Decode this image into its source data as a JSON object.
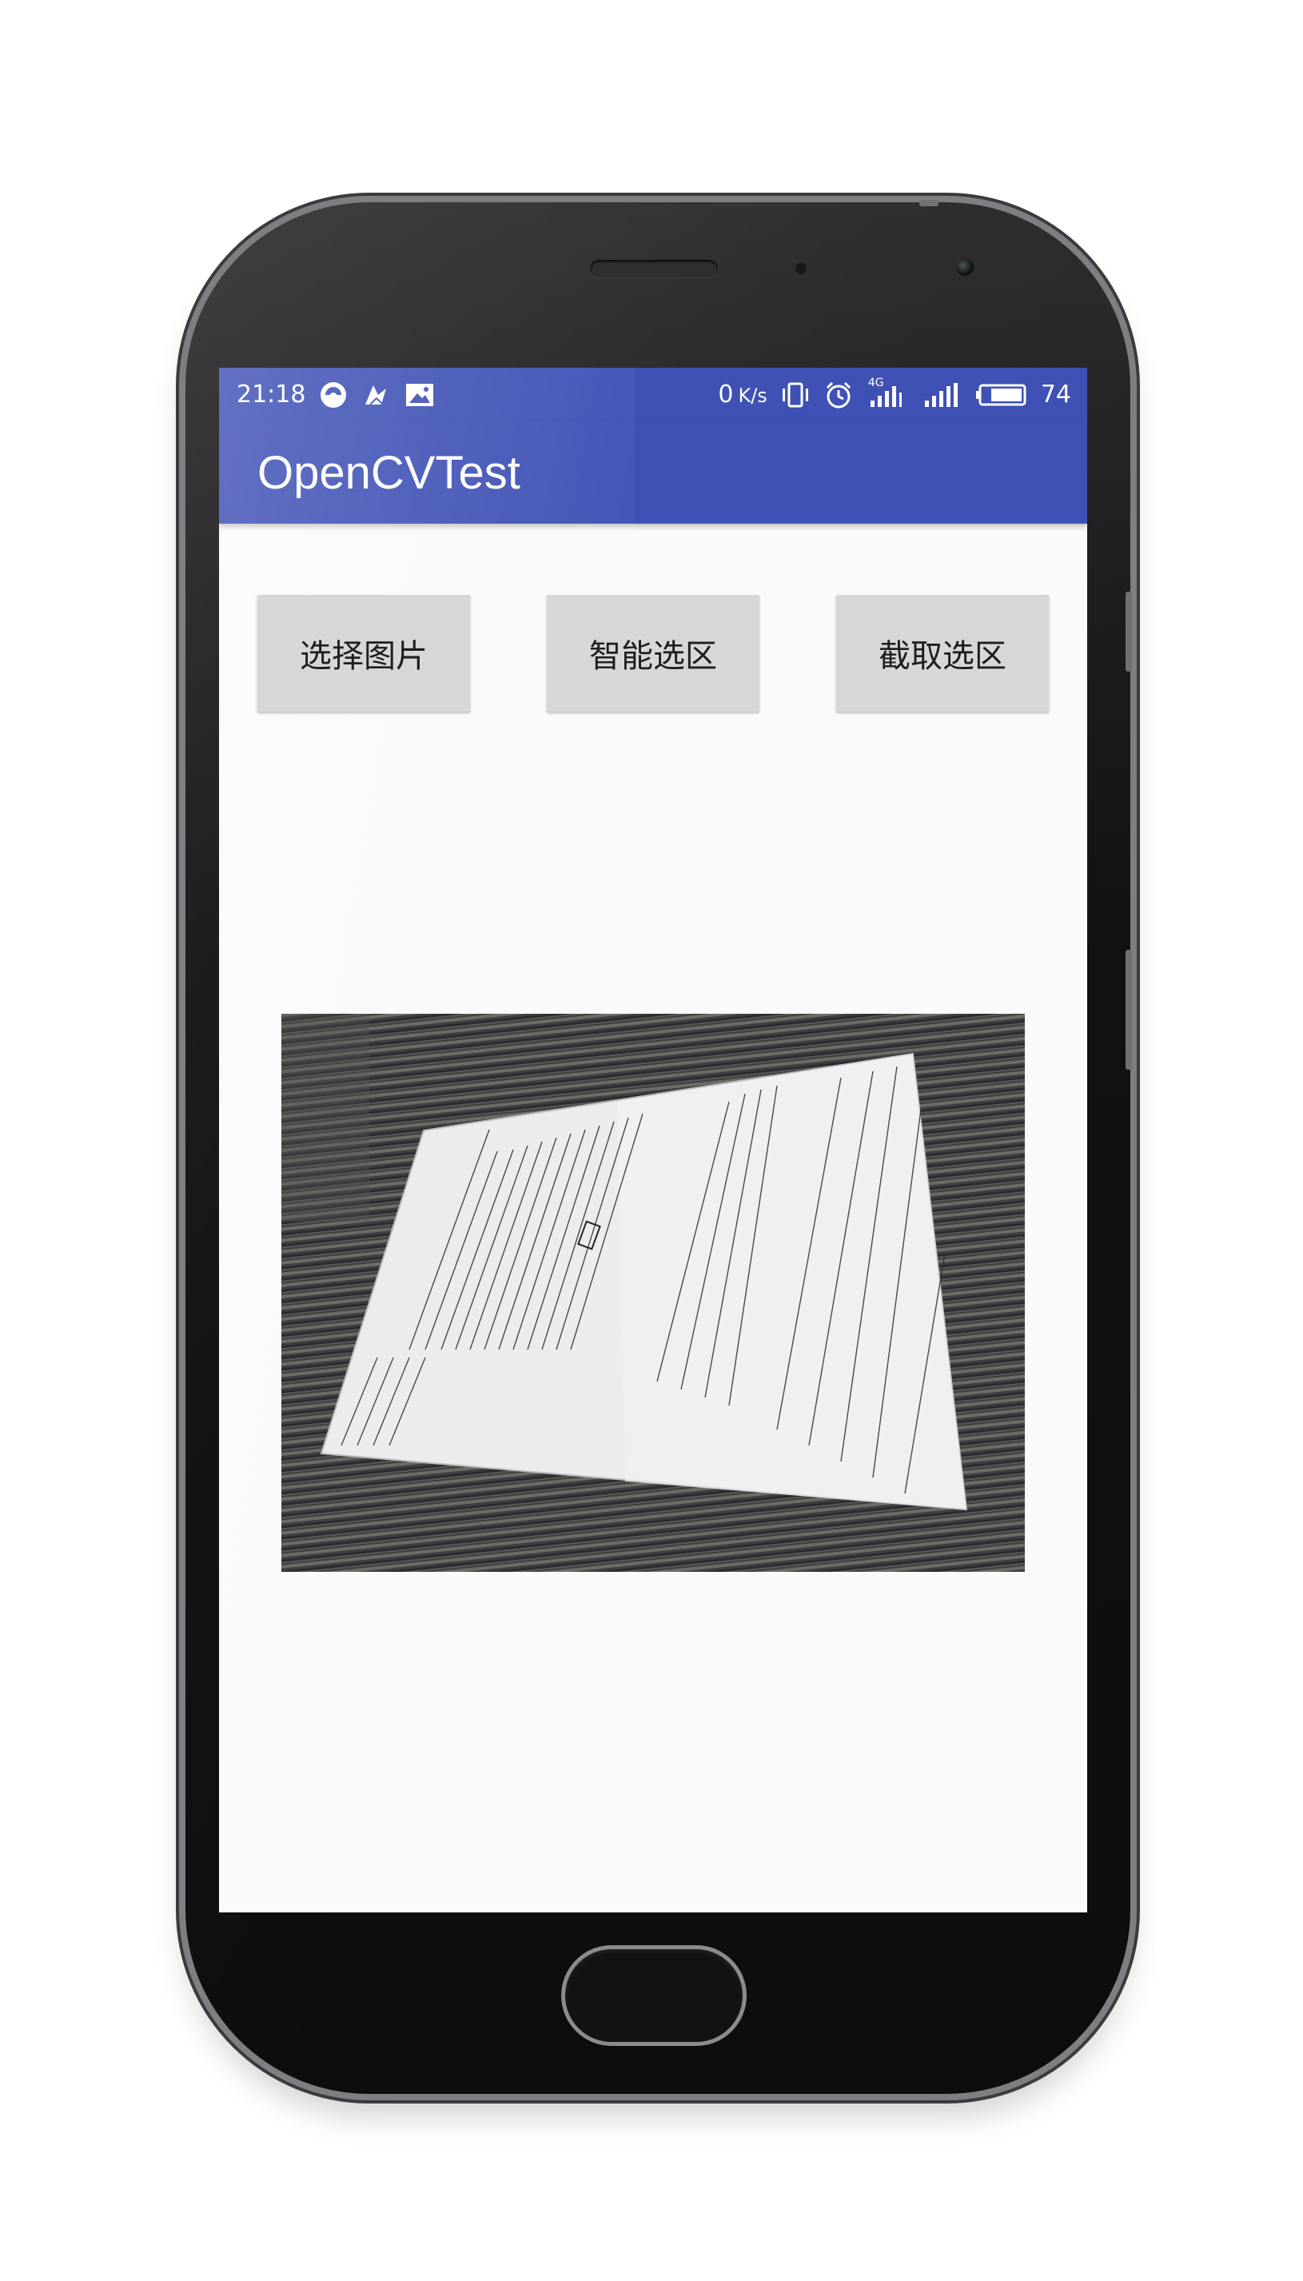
{
  "statusbar": {
    "time": "21:18",
    "speed_value": "0",
    "speed_unit": "K/s",
    "network_type": "4G",
    "battery": "74"
  },
  "app": {
    "title": "OpenCVTest"
  },
  "toolbar": {
    "select_image_label": "选择图片",
    "smart_select_label": "智能选区",
    "crop_label": "截取选区"
  },
  "image": {
    "description_icon": "photo-of-handwritten-page"
  },
  "colors": {
    "primary": "#3f51b5",
    "button_bg": "#d6d7d7",
    "screen_bg": "#fafafa"
  }
}
